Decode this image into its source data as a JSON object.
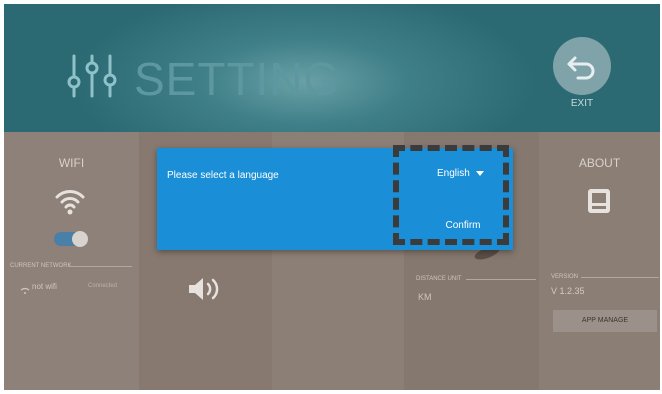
{
  "header": {
    "title": "SETTING",
    "title_icon": "sliders-icon",
    "exit_label": "EXIT",
    "exit_icon": "return-arrow-icon"
  },
  "wifi": {
    "heading": "WIFI",
    "icon": "wifi-icon",
    "toggle_on": true,
    "current_network_label": "CURRENT NETWORK",
    "network_name": "not wifi",
    "network_status": "Connected"
  },
  "volume": {
    "icon": "volume-icon"
  },
  "distance": {
    "label": "DISTANCE UNIT",
    "value": "KM"
  },
  "about": {
    "heading": "ABOUT",
    "icon": "device-icon",
    "version_label": "VERSION",
    "version_value": "V 1.2.35",
    "app_manage_label": "APP MANAGE"
  },
  "dialog": {
    "prompt": "Please select a language",
    "selected_language": "English",
    "confirm_label": "Confirm"
  },
  "colors": {
    "header": "#2c6a73",
    "dialog": "#1a8ed6",
    "panel": "#8b7f76",
    "highlight_border": "#3b3b3b"
  }
}
